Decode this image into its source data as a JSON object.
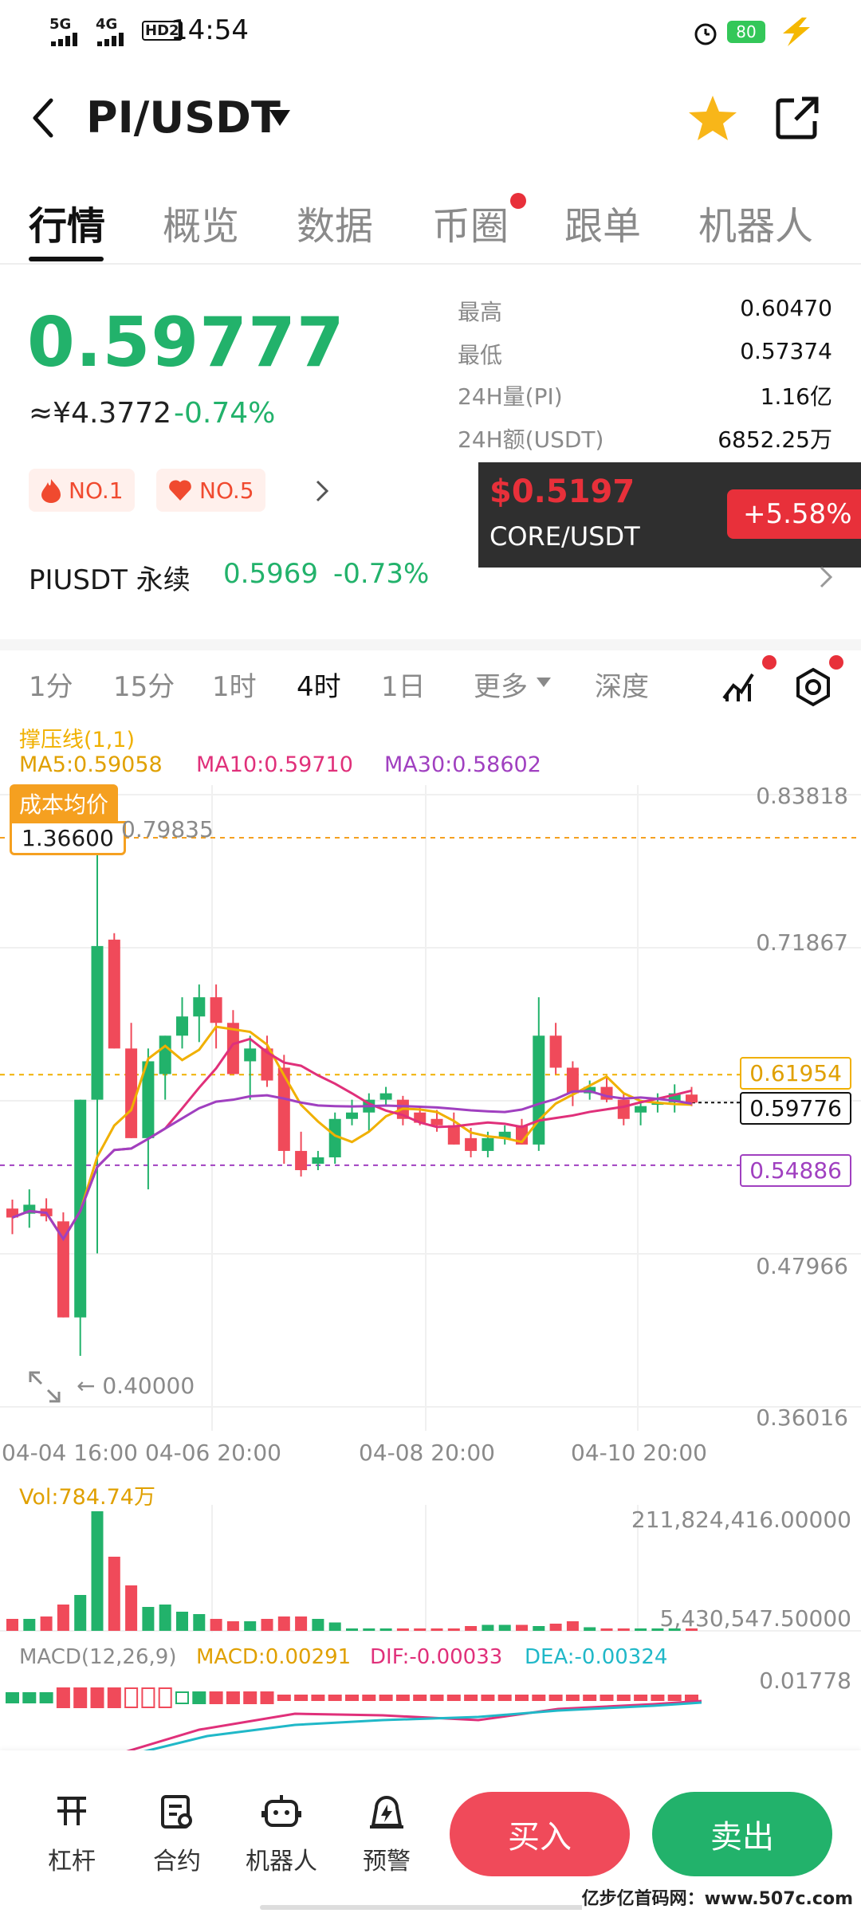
{
  "status": {
    "network1": "5G",
    "network2": "4G",
    "hd": "HD2",
    "time": "14:54",
    "battery": "80"
  },
  "header": {
    "pair": "PI/USDT"
  },
  "tabs": [
    {
      "label": "行情"
    },
    {
      "label": "概览"
    },
    {
      "label": "数据"
    },
    {
      "label": "币圈"
    },
    {
      "label": "跟单"
    },
    {
      "label": "机器人"
    }
  ],
  "ticker": {
    "price": "0.59777",
    "cny": "≈¥4.3772",
    "change": "-0.74%"
  },
  "stats": [
    {
      "label": "最高",
      "value": "0.60470"
    },
    {
      "label": "最低",
      "value": "0.57374"
    },
    {
      "label": "24H量(PI)",
      "value": "1.16亿"
    },
    {
      "label": "24H额(USDT)",
      "value": "6852.25万"
    }
  ],
  "badges": [
    {
      "label": "NO.1"
    },
    {
      "label": "NO.5"
    }
  ],
  "promo": {
    "price": "$0.5197",
    "pair": "CORE/USDT",
    "change": "+5.58%"
  },
  "perp": {
    "name": "PIUSDT 永续",
    "price": "0.5969",
    "change": "-0.73%"
  },
  "intervals": [
    {
      "label": "1分"
    },
    {
      "label": "15分"
    },
    {
      "label": "1时"
    },
    {
      "label": "4时"
    },
    {
      "label": "1日"
    },
    {
      "label": "更多"
    },
    {
      "label": "深度"
    }
  ],
  "indicators": {
    "line": "撑压线(1,1)",
    "ma5": "MA5:0.59058",
    "ma10": "MA10:0.59710",
    "ma30": "MA30:0.58602"
  },
  "chart": {
    "cost_label": "成本均价",
    "cost_value": "1.36600",
    "high_note": "0.79835",
    "low_note": "← 0.40000",
    "y_ticks": [
      "0.83818",
      "0.71867",
      "0.47966",
      "0.36016"
    ],
    "tag_resist": "0.61954",
    "tag_current": "0.59776",
    "tag_support": "0.54886",
    "x_ticks": [
      "04-04 16:00",
      "04-06 20:00",
      "04-08 20:00",
      "04-10 20:00"
    ]
  },
  "volume": {
    "label": "Vol:784.74万",
    "top": "211,824,416.00000",
    "bottom": "5,430,547.50000"
  },
  "macd": {
    "name": "MACD(12,26,9)",
    "macd": "MACD:0.00291",
    "dif": "DIF:-0.00033",
    "dea": "DEA:-0.00324",
    "axis": "0.01778"
  },
  "bottom_nav": [
    {
      "label": "杠杆"
    },
    {
      "label": "合约"
    },
    {
      "label": "机器人"
    },
    {
      "label": "预警"
    }
  ],
  "actions": {
    "buy": "买入",
    "sell": "卖出"
  },
  "watermark": "亿步亿首码网：www.507c.com",
  "colors": {
    "up": "#22b26b",
    "down": "#f04a5a",
    "ma5": "#f0b000",
    "ma10": "#e0307a",
    "ma30": "#a040c0",
    "promo_red": "#e8303a"
  },
  "chart_data": {
    "type": "candlestick",
    "y_axis_ticks": [
      0.83818,
      0.71867,
      0.47966,
      0.36016
    ],
    "reference_lines": {
      "resistance": 0.61954,
      "current": 0.59776,
      "support": 0.54886,
      "cost_average": 1.366,
      "period_high": 0.79835,
      "period_low": 0.4
    },
    "x_axis_ticks": [
      "04-04 16:00",
      "04-06 20:00",
      "04-08 20:00",
      "04-10 20:00"
    ],
    "candles": [
      {
        "o": 0.515,
        "h": 0.522,
        "l": 0.495,
        "c": 0.508
      },
      {
        "o": 0.511,
        "h": 0.53,
        "l": 0.5,
        "c": 0.518
      },
      {
        "o": 0.515,
        "h": 0.523,
        "l": 0.505,
        "c": 0.509
      },
      {
        "o": 0.505,
        "h": 0.512,
        "l": 0.43,
        "c": 0.43
      },
      {
        "o": 0.43,
        "h": 0.6,
        "l": 0.4,
        "c": 0.6
      },
      {
        "o": 0.6,
        "h": 0.79835,
        "l": 0.48,
        "c": 0.72
      },
      {
        "o": 0.725,
        "h": 0.73,
        "l": 0.64,
        "c": 0.64
      },
      {
        "o": 0.64,
        "h": 0.66,
        "l": 0.57,
        "c": 0.57
      },
      {
        "o": 0.57,
        "h": 0.64,
        "l": 0.53,
        "c": 0.63
      },
      {
        "o": 0.62,
        "h": 0.65,
        "l": 0.6,
        "c": 0.65
      },
      {
        "o": 0.65,
        "h": 0.68,
        "l": 0.64,
        "c": 0.665
      },
      {
        "o": 0.665,
        "h": 0.69,
        "l": 0.645,
        "c": 0.68
      },
      {
        "o": 0.68,
        "h": 0.69,
        "l": 0.64,
        "c": 0.66
      },
      {
        "o": 0.66,
        "h": 0.67,
        "l": 0.62,
        "c": 0.62
      },
      {
        "o": 0.63,
        "h": 0.65,
        "l": 0.6,
        "c": 0.64
      },
      {
        "o": 0.64,
        "h": 0.65,
        "l": 0.61,
        "c": 0.615
      },
      {
        "o": 0.625,
        "h": 0.635,
        "l": 0.55,
        "c": 0.56
      },
      {
        "o": 0.56,
        "h": 0.575,
        "l": 0.54,
        "c": 0.545
      },
      {
        "o": 0.55,
        "h": 0.56,
        "l": 0.545,
        "c": 0.555
      },
      {
        "o": 0.555,
        "h": 0.59,
        "l": 0.55,
        "c": 0.585
      },
      {
        "o": 0.585,
        "h": 0.6,
        "l": 0.58,
        "c": 0.59
      },
      {
        "o": 0.59,
        "h": 0.605,
        "l": 0.575,
        "c": 0.6
      },
      {
        "o": 0.6,
        "h": 0.61,
        "l": 0.595,
        "c": 0.605
      },
      {
        "o": 0.6,
        "h": 0.603,
        "l": 0.58,
        "c": 0.585
      },
      {
        "o": 0.59,
        "h": 0.595,
        "l": 0.58,
        "c": 0.582
      },
      {
        "o": 0.585,
        "h": 0.592,
        "l": 0.575,
        "c": 0.58
      },
      {
        "o": 0.58,
        "h": 0.59,
        "l": 0.565,
        "c": 0.565
      },
      {
        "o": 0.57,
        "h": 0.578,
        "l": 0.555,
        "c": 0.56
      },
      {
        "o": 0.56,
        "h": 0.575,
        "l": 0.555,
        "c": 0.57
      },
      {
        "o": 0.57,
        "h": 0.58,
        "l": 0.565,
        "c": 0.575
      },
      {
        "o": 0.58,
        "h": 0.585,
        "l": 0.565,
        "c": 0.565
      },
      {
        "o": 0.565,
        "h": 0.68,
        "l": 0.56,
        "c": 0.65
      },
      {
        "o": 0.65,
        "h": 0.66,
        "l": 0.62,
        "c": 0.625
      },
      {
        "o": 0.625,
        "h": 0.63,
        "l": 0.595,
        "c": 0.605
      },
      {
        "o": 0.605,
        "h": 0.615,
        "l": 0.6,
        "c": 0.61
      },
      {
        "o": 0.61,
        "h": 0.618,
        "l": 0.598,
        "c": 0.6
      },
      {
        "o": 0.6,
        "h": 0.605,
        "l": 0.58,
        "c": 0.585
      },
      {
        "o": 0.59,
        "h": 0.6,
        "l": 0.58,
        "c": 0.595
      },
      {
        "o": 0.596,
        "h": 0.605,
        "l": 0.59,
        "c": 0.598
      },
      {
        "o": 0.598,
        "h": 0.612,
        "l": 0.59,
        "c": 0.605
      },
      {
        "o": 0.604,
        "h": 0.61,
        "l": 0.595,
        "c": 0.59776
      }
    ],
    "volume_axis": [
      211824416.0,
      5430547.5
    ],
    "volume": [
      0.1,
      0.1,
      0.12,
      0.22,
      0.3,
      1.0,
      0.62,
      0.38,
      0.2,
      0.22,
      0.16,
      0.14,
      0.1,
      0.08,
      0.08,
      0.1,
      0.12,
      0.12,
      0.1,
      0.07,
      0.02,
      0.02,
      0.02,
      0.02,
      0.02,
      0.02,
      0.02,
      0.04,
      0.05,
      0.05,
      0.05,
      0.04,
      0.06,
      0.08,
      0.03,
      0.02,
      0.02,
      0.02,
      0.02,
      0.02,
      0.02
    ],
    "macd_axis_top": 0.01778
  }
}
